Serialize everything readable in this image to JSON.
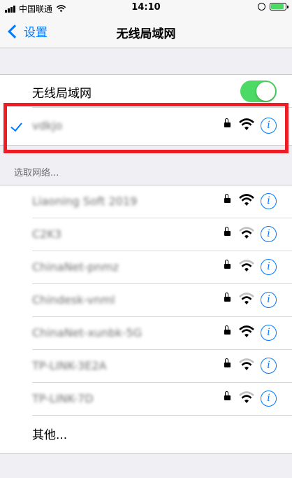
{
  "status_bar": {
    "carrier": "中国联通",
    "time": "14:10"
  },
  "nav": {
    "back_label": "设置",
    "title": "无线局域网"
  },
  "wifi_toggle": {
    "label": "无线局域网",
    "on": true
  },
  "connected_network": {
    "name": "vdkjo"
  },
  "section_header": "选取网络...",
  "networks": [
    {
      "name": "Liaoning Soft 2019"
    },
    {
      "name": "C2K3"
    },
    {
      "name": "ChinaNet-pnmz"
    },
    {
      "name": "Chindesk-vnml"
    },
    {
      "name": "ChinaNet-xunbk-5G"
    },
    {
      "name": "TP-LINK-3E2A"
    },
    {
      "name": "TP-LINK-7D"
    }
  ],
  "other_label": "其他...",
  "colors": {
    "accent": "#007aff",
    "toggle_on": "#4cd964",
    "highlight": "#ee1c25"
  }
}
